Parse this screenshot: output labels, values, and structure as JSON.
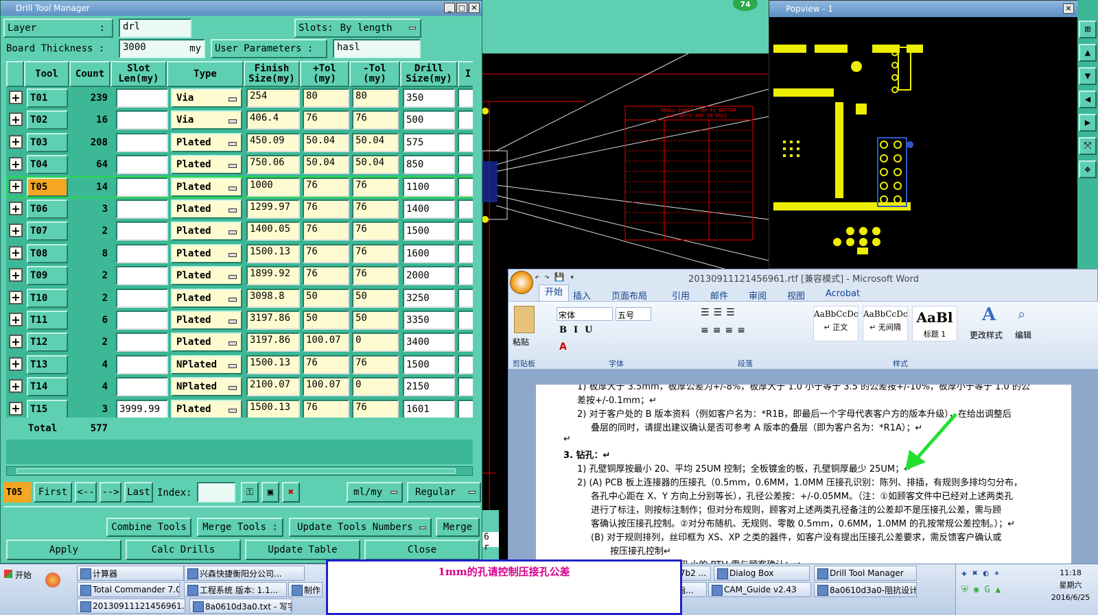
{
  "dtm": {
    "title": "Drill Tool Manager",
    "layer_label": "Layer",
    "layer_sep": ":",
    "layer_value": "drl",
    "slots_label": "Slots:",
    "slots_value": "By length",
    "thickness_label": "Board Thickness :",
    "thickness_value": "3000",
    "thickness_unit": "my",
    "user_params_label": "User Parameters :",
    "user_params_value": "hasl",
    "headers": {
      "tool": "Tool",
      "count": "Count",
      "slot": "Slot\nLen(my)",
      "type": "Type",
      "finish": "Finish\nSize(my)",
      "ptol": "+Tol\n(my)",
      "ntol": "-Tol\n(my)",
      "drill": "Drill\nSize(my)",
      "extra": "I"
    },
    "rows": [
      {
        "tool": "T01",
        "count": "239",
        "slot": "",
        "type": "Via",
        "finish": "254",
        "ptol": "80",
        "ntol": "80",
        "drill": "350"
      },
      {
        "tool": "T02",
        "count": "16",
        "slot": "",
        "type": "Via",
        "finish": "406.4",
        "ptol": "76",
        "ntol": "76",
        "drill": "500"
      },
      {
        "tool": "T03",
        "count": "208",
        "slot": "",
        "type": "Plated",
        "finish": "450.09",
        "ptol": "50.04",
        "ntol": "50.04",
        "drill": "575"
      },
      {
        "tool": "T04",
        "count": "64",
        "slot": "",
        "type": "Plated",
        "finish": "750.06",
        "ptol": "50.04",
        "ntol": "50.04",
        "drill": "850"
      },
      {
        "tool": "T05",
        "count": "14",
        "slot": "",
        "type": "Plated",
        "finish": "1000",
        "ptol": "76",
        "ntol": "76",
        "drill": "1100"
      },
      {
        "tool": "T06",
        "count": "3",
        "slot": "",
        "type": "Plated",
        "finish": "1299.97",
        "ptol": "76",
        "ntol": "76",
        "drill": "1400"
      },
      {
        "tool": "T07",
        "count": "2",
        "slot": "",
        "type": "Plated",
        "finish": "1400.05",
        "ptol": "76",
        "ntol": "76",
        "drill": "1500"
      },
      {
        "tool": "T08",
        "count": "8",
        "slot": "",
        "type": "Plated",
        "finish": "1500.13",
        "ptol": "76",
        "ntol": "76",
        "drill": "1600"
      },
      {
        "tool": "T09",
        "count": "2",
        "slot": "",
        "type": "Plated",
        "finish": "1899.92",
        "ptol": "76",
        "ntol": "76",
        "drill": "2000"
      },
      {
        "tool": "T10",
        "count": "2",
        "slot": "",
        "type": "Plated",
        "finish": "3098.8",
        "ptol": "50",
        "ntol": "50",
        "drill": "3250"
      },
      {
        "tool": "T11",
        "count": "6",
        "slot": "",
        "type": "Plated",
        "finish": "3197.86",
        "ptol": "50",
        "ntol": "50",
        "drill": "3350"
      },
      {
        "tool": "T12",
        "count": "2",
        "slot": "",
        "type": "Plated",
        "finish": "3197.86",
        "ptol": "100.07",
        "ntol": "0",
        "drill": "3400"
      },
      {
        "tool": "T13",
        "count": "4",
        "slot": "",
        "type": "NPlated",
        "finish": "1500.13",
        "ptol": "76",
        "ntol": "76",
        "drill": "1500"
      },
      {
        "tool": "T14",
        "count": "4",
        "slot": "",
        "type": "NPlated",
        "finish": "2100.07",
        "ptol": "100.07",
        "ntol": "0",
        "drill": "2150"
      },
      {
        "tool": "T15",
        "count": "3",
        "slot": "3999.99",
        "type": "Plated",
        "finish": "1500.13",
        "ptol": "76",
        "ntol": "76",
        "drill": "1601"
      }
    ],
    "total_label": "Total",
    "total_value": "577",
    "current_tool": "T05",
    "nav": {
      "first": "First",
      "prev": "<--",
      "next": "-->",
      "last": "Last",
      "index_label": "Index:"
    },
    "units_value": "ml/my",
    "mode_value": "Regular",
    "combine_label": "Combine Tools",
    "merge_tools_label": "Merge Tools :",
    "update_numbers_label": "Update Tools Numbers",
    "merge_label": "Merge",
    "apply_label": "Apply",
    "calc_label": "Calc Drills",
    "update_table_label": "Update Table",
    "close_label": "Close"
  },
  "cam": {
    "badge": "74",
    "status": "6 r"
  },
  "popview": {
    "title": "Popview - 1"
  },
  "word": {
    "title": "20130911121456961.rtf [兼容模式] - Microsoft Word",
    "tabs": [
      "开始",
      "插入",
      "页面布局",
      "引用",
      "邮件",
      "审阅",
      "视图",
      "Acrobat"
    ],
    "paste_label": "粘贴",
    "clipboard_label": "剪贴板",
    "font_name": "宋体",
    "font_size": "五号",
    "font_group": "字体",
    "para_group": "段落",
    "styles_group": "样式",
    "styles": [
      {
        "sample": "AaBbCcDc",
        "name": "↵ 正文"
      },
      {
        "sample": "AaBbCcDc",
        "name": "↵ 无间隔"
      },
      {
        "sample": "AaBl",
        "name": "标题 1"
      }
    ],
    "change_styles": "更改样式",
    "edit_label": "编辑",
    "lines": [
      "1)  板厚大于 3.5mm，板厚公差为+/-8%，板厚大于 1.0 小于等于 3.5 的公差按+/-10%，板厚小于等于 1.0 的公",
      "差按+/-0.1mm；↵",
      "2)  对于客户处的 B 版本资料（例如客户名为：*R1B，即最后一个字母代表客户方的版本升级），在给出调整后",
      "叠层的同时，请提出建议确认是否可参考 A 版本的叠层（即为客户名为：*R1A）；↵",
      "↵",
      "3.   钻孔：↵",
      "1)  孔壁铜厚按最小 20、平均 25UM 控制；全板镀金的板，孔壁铜厚最少 25UM；↵",
      "2)  (A) PCB 板上连接器的压接孔（0.5mm，0.6MM，1.0MM 压接孔识别：陈列、排插，有规则多排均匀分布，",
      "各孔中心距在 X、Y 方向上分别等长），孔径公差按：+/-0.05MM。（注：①如顾客文件中已经对上述两类孔",
      "进行了标注，则按标注制作；但对分布规则，顾客对上述两类孔径备注的公差却不是压接孔公差，需与顾",
      "客确认按压接孔控制。②对分布随机、无规则、零散 0.5mm，0.6MM，1.0MM 的孔按常规公差控制。）；↵",
      "(B) 对于规则排列，丝印框为 XS、XP 之类的器件，如客户没有提出压接孔公差要求，需反馈客户确认或",
      "按压接孔控制↵",
      "      ...盘孔等大或盘比孔小的 PTH 需与顾客确认；↵"
    ]
  },
  "popup_text": "1mm的孔请控制压接孔公差",
  "taskbar": {
    "start": "开始",
    "row1": [
      "计算器",
      "兴森快捷衡阳分公司...",
      "r 9.07b2 ...",
      "Dialog Box",
      "Drill Tool Manager"
    ],
    "row2": [
      "Total Commander 7.0 p...",
      "工程系统  版本: 1.1...",
      "制作",
      "…审指...",
      "CAM_Guide v2.43",
      "8a0610d3a0-阻抗设计..."
    ],
    "row3": [
      "20130911121456961....",
      "8a0610d3a0.txt - 写字板"
    ],
    "clock_time": "11:18",
    "clock_day": "星期六",
    "clock_date": "2016/6/25"
  },
  "colors": {
    "accent": "#5fcfb2",
    "highlight": "#f5a623",
    "popup_border": "#1e22c8",
    "popup_text": "#d6008c"
  }
}
